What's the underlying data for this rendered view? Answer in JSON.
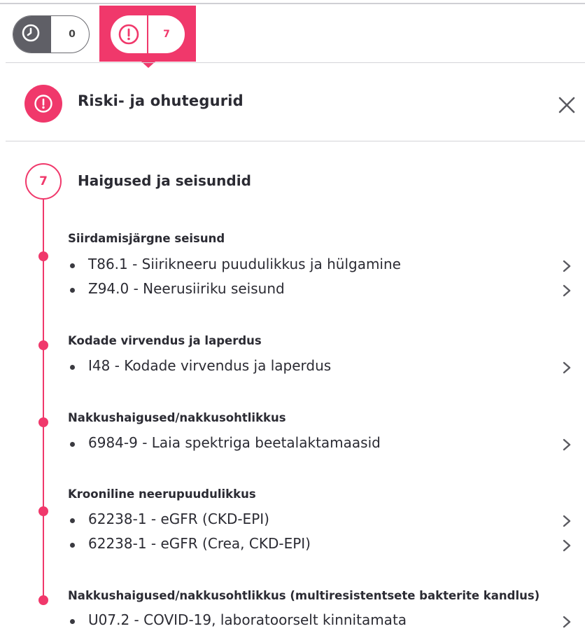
{
  "toggles": {
    "history_count": "0",
    "risk_count": "7"
  },
  "panel": {
    "title": "Riski- ja ohutegurid",
    "close_label": "Close"
  },
  "section": {
    "count": "7",
    "title": "Haigused ja seisundid"
  },
  "groups": [
    {
      "title": "Siirdamisjärgne seisund",
      "items": [
        "T86.1 - Siirikneeru puudulikkus ja hülgamine",
        "Z94.0 - Neerusiiriku seisund"
      ]
    },
    {
      "title": "Kodade virvendus ja laperdus",
      "items": [
        "I48 - Kodade virvendus ja laperdus"
      ]
    },
    {
      "title": "Nakkushaigused/nakkusohtlikkus",
      "items": [
        "6984-9 - Laia spektriga beetalaktamaasid"
      ]
    },
    {
      "title": "Krooniline neerupuudulikkus",
      "items": [
        "62238-1 - eGFR (CKD-EPI)",
        "62238-1 - eGFR (Crea, CKD-EPI)"
      ]
    },
    {
      "title": "Nakkushaigused/nakkusohtlikkus (multiresistentsete bakterite kandlus)",
      "items": [
        "U07.2 - COVID-19, laboratoorselt kinnitamata"
      ]
    }
  ],
  "colors": {
    "accent": "#f0386b",
    "text": "#2b2b33",
    "gray": "#5f5f66"
  },
  "icons": {
    "history": "clock-icon",
    "risk": "alert-circle-icon",
    "close": "close-icon",
    "chevron": "chevron-right-icon"
  }
}
